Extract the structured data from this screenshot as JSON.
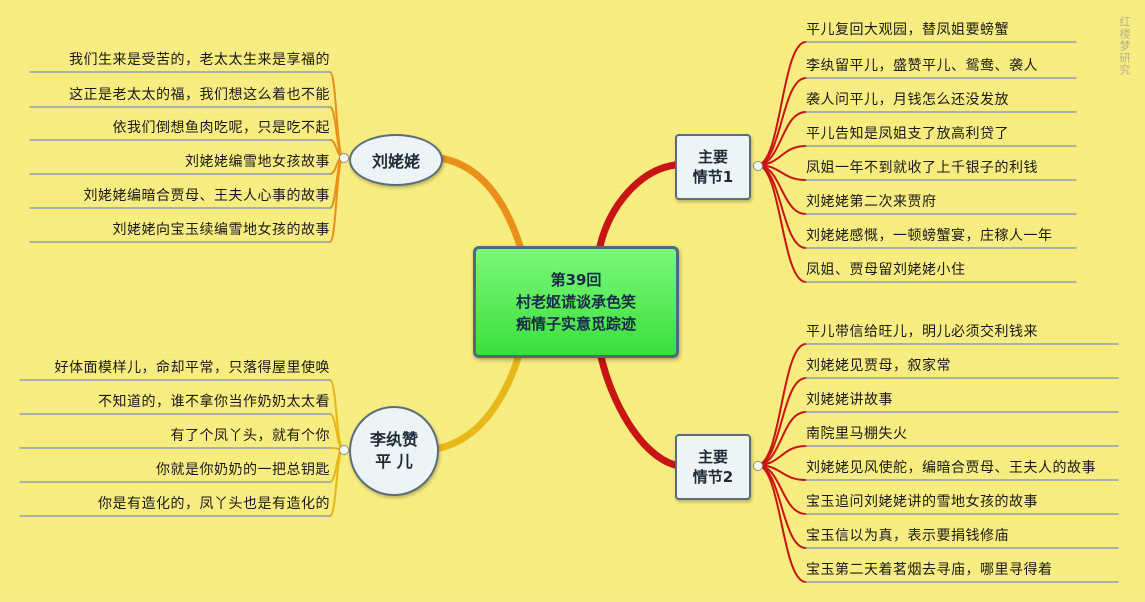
{
  "central": {
    "line1": "第39回",
    "line2": "村老妪谎谈承色笑",
    "line3": "痴情子实意觅踪迹"
  },
  "left_top": {
    "label": "刘姥姥",
    "leaves": [
      "我们生来是受苦的，老太太生来是享福的",
      "这正是老太太的福，我们想这么着也不能",
      "依我们倒想鱼肉吃呢，只是吃不起",
      "刘姥姥编雪地女孩故事",
      "刘姥姥编暗合贾母、王夫人心事的故事",
      "刘姥姥向宝玉续编雪地女孩的故事"
    ]
  },
  "left_bottom": {
    "label_line1": "李纨赞",
    "label_line2": "平 儿",
    "leaves": [
      "好体面模样儿，命却平常，只落得屋里使唤",
      "不知道的，谁不拿你当作奶奶太太看",
      "有了个凤丫头，就有个你",
      "你就是你奶奶的一把总钥匙",
      "你是有造化的，凤丫头也是有造化的"
    ]
  },
  "right_top": {
    "label_line1": "主要",
    "label_line2": "情节1",
    "leaves": [
      "平儿复回大观园，替凤姐要螃蟹",
      "李纨留平儿，盛赞平儿、鸳鸯、袭人",
      "袭人问平儿，月钱怎么还没发放",
      "平儿告知是凤姐支了放高利贷了",
      "凤姐一年不到就收了上千银子的利钱",
      "刘姥姥第二次来贾府",
      "刘姥姥感慨，一顿螃蟹宴，庄稼人一年",
      "凤姐、贾母留刘姥姥小住"
    ]
  },
  "right_bottom": {
    "label_line1": "主要",
    "label_line2": "情节2",
    "leaves": [
      "平儿带信给旺儿，明儿必须交利钱来",
      "刘姥姥见贾母，叙家常",
      "刘姥姥讲故事",
      "南院里马棚失火",
      "刘姥姥见风使舵，编暗合贾母、王夫人的故事",
      "宝玉追问刘姥姥讲的雪地女孩的故事",
      "宝玉信以为真，表示要捐钱修庙",
      "宝玉第二天着茗烟去寻庙，哪里寻得着"
    ]
  },
  "watermark": "红楼梦研究",
  "colors": {
    "background": "#f7ec7c",
    "branch_left_top": "#e8901a",
    "branch_left_bottom": "#e8b81a",
    "branch_right": "#c81414",
    "leaf_line": "#8aa0b4",
    "central_fill": "#4ae84a"
  }
}
